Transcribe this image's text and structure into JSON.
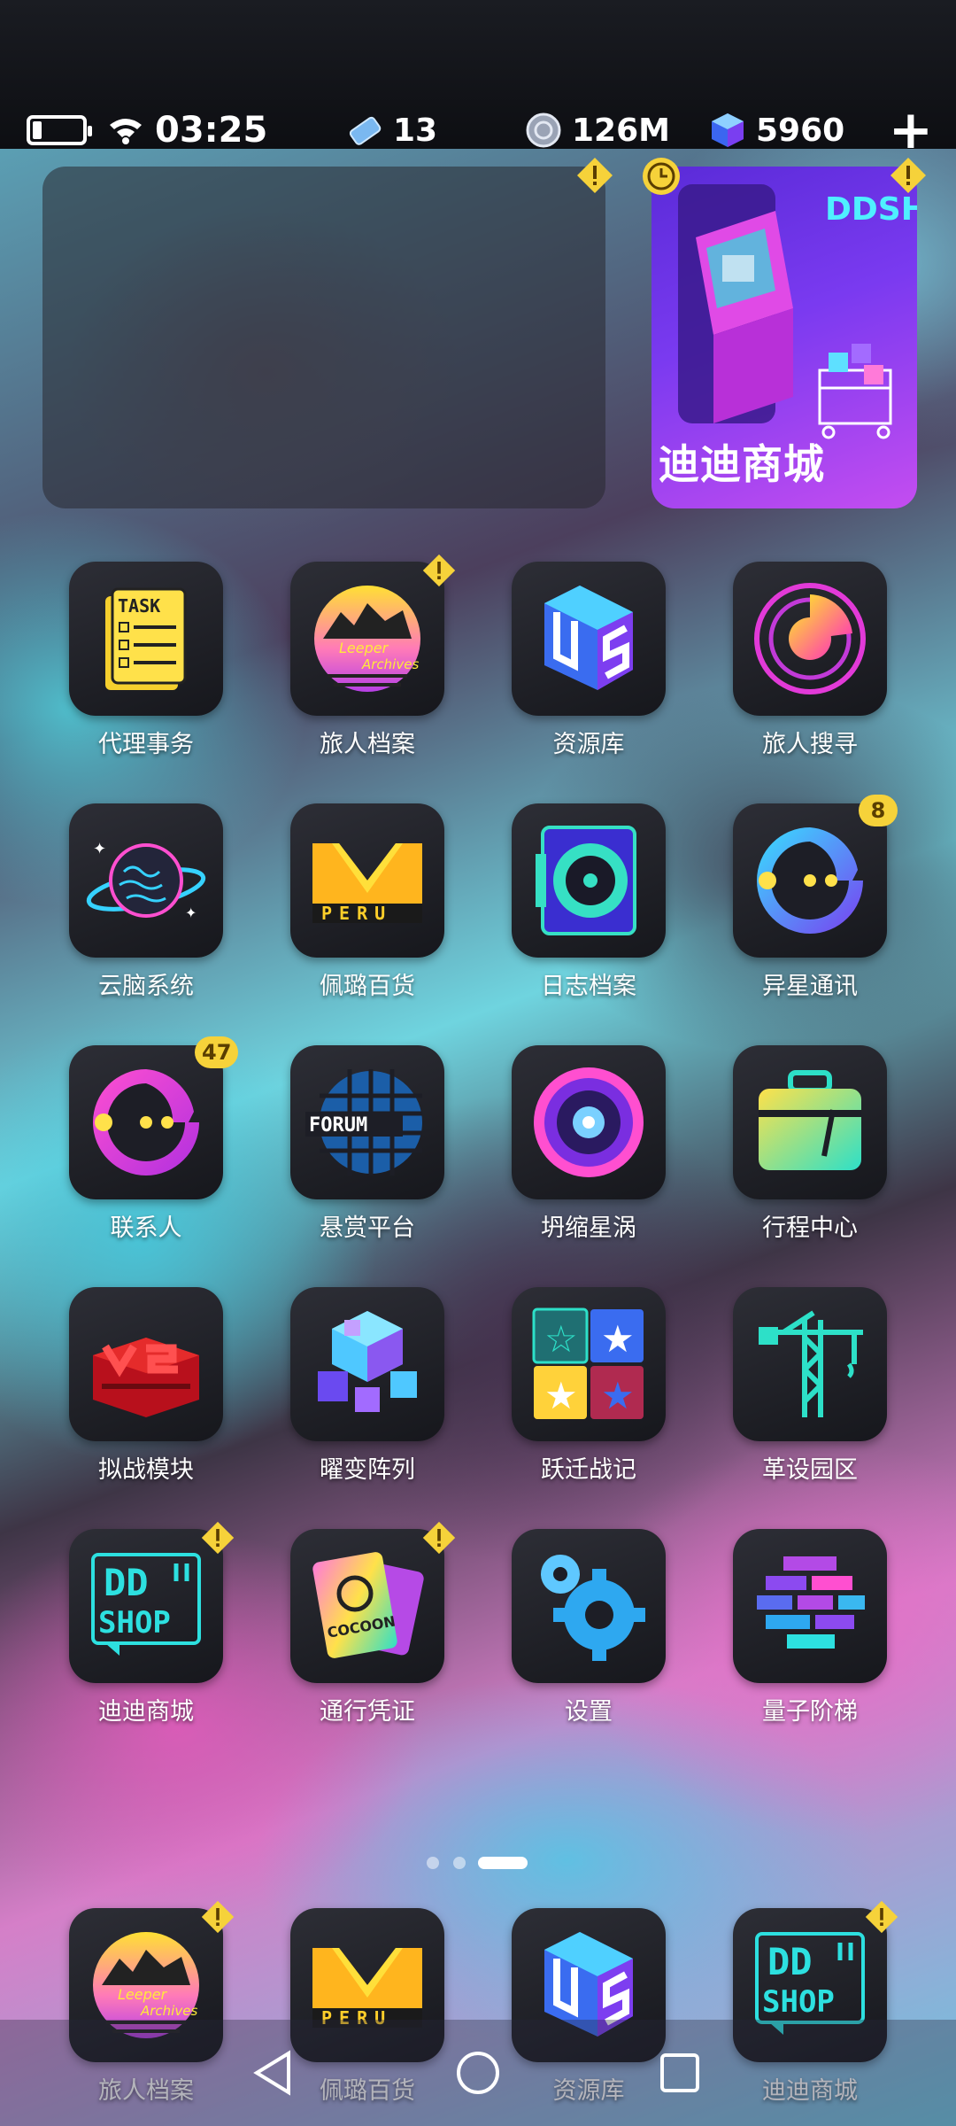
{
  "status_bar": {
    "time": "03:25",
    "tickets": "13",
    "coins": "126M",
    "gems": "5960",
    "battery_icon": "battery-low-icon",
    "wifi_icon": "wifi-icon",
    "add_icon": "plus-icon"
  },
  "widget": {
    "shop_label": "迪迪商城",
    "shop_logo": "DDSHOP"
  },
  "apps": [
    {
      "label": "代理事务",
      "icon": "task-list-icon",
      "badge": ""
    },
    {
      "label": "旅人档案",
      "icon": "leeper-archives-icon",
      "badge": "!"
    },
    {
      "label": "资源库",
      "icon": "cube-storage-icon",
      "badge": ""
    },
    {
      "label": "旅人搜寻",
      "icon": "radar-icon",
      "badge": ""
    },
    {
      "label": "云脑系统",
      "icon": "brain-planet-icon",
      "badge": ""
    },
    {
      "label": "佩璐百货",
      "icon": "peru-m-icon",
      "badge": ""
    },
    {
      "label": "日志档案",
      "icon": "disc-log-icon",
      "badge": ""
    },
    {
      "label": "异星通讯",
      "icon": "pacman-chat-icon",
      "badge": "8"
    },
    {
      "label": "联系人",
      "icon": "pacman-contact-icon",
      "badge": "47"
    },
    {
      "label": "悬赏平台",
      "icon": "forum-globe-icon",
      "badge": ""
    },
    {
      "label": "坍缩星涡",
      "icon": "vortex-eye-icon",
      "badge": ""
    },
    {
      "label": "行程中心",
      "icon": "suitcase-icon",
      "badge": ""
    },
    {
      "label": "拟战模块",
      "icon": "vs-module-icon",
      "badge": ""
    },
    {
      "label": "曜变阵列",
      "icon": "cube-array-icon",
      "badge": ""
    },
    {
      "label": "跃迁战记",
      "icon": "star-grid-icon",
      "badge": ""
    },
    {
      "label": "革设园区",
      "icon": "crane-icon",
      "badge": ""
    },
    {
      "label": "迪迪商城",
      "icon": "ddshop-icon",
      "badge": "!"
    },
    {
      "label": "通行凭证",
      "icon": "cocoon-pass-icon",
      "badge": "!"
    },
    {
      "label": "设置",
      "icon": "gears-icon",
      "badge": ""
    },
    {
      "label": "量子阶梯",
      "icon": "quantum-bricks-icon",
      "badge": ""
    }
  ],
  "dock": [
    {
      "label": "旅人档案",
      "icon": "leeper-archives-icon",
      "badge": "!"
    },
    {
      "label": "佩璐百货",
      "icon": "peru-m-icon",
      "badge": ""
    },
    {
      "label": "资源库",
      "icon": "cube-storage-icon",
      "badge": ""
    },
    {
      "label": "迪迪商城",
      "icon": "ddshop-icon",
      "badge": "!"
    }
  ],
  "pages": {
    "count": 3,
    "current": 3
  },
  "navbar": {
    "back_icon": "back-triangle-icon",
    "home_icon": "home-circle-icon",
    "recents_icon": "recents-square-icon"
  },
  "icon_text": {
    "task": "TASK",
    "leeper_1": "Leeper",
    "leeper_2": "Archives",
    "peru": "PERU",
    "forum": "FORUM",
    "cocoon": "COCOON",
    "dd": "DD",
    "shop": "SHOP"
  }
}
